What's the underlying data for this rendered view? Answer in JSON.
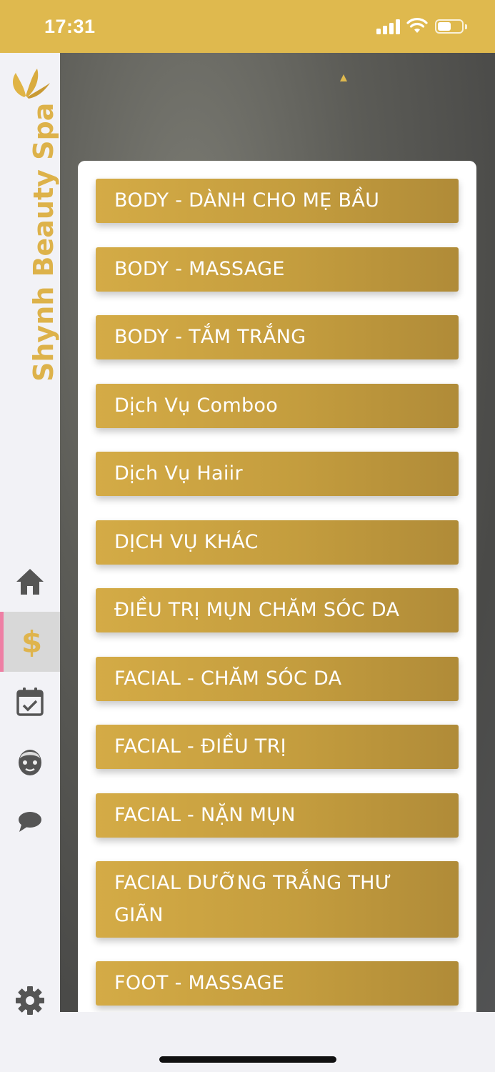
{
  "status": {
    "time": "17:31",
    "battery_level": 0.55
  },
  "sidebar": {
    "brand": "Shynh Beauty Spa",
    "nav": [
      {
        "icon": "home-icon",
        "active": false
      },
      {
        "icon": "dollar-icon",
        "label": "$",
        "active": true
      },
      {
        "icon": "calendar-check-icon",
        "active": false
      },
      {
        "icon": "face-mask-icon",
        "active": false
      },
      {
        "icon": "chat-bubble-icon",
        "active": false
      }
    ],
    "settings_icon": "gear-icon"
  },
  "services": [
    "BODY - DÀNH CHO MẸ BẦU",
    "BODY - MASSAGE",
    "BODY - TẮM TRẮNG",
    "Dịch Vụ Comboo",
    "Dịch Vụ Haiir",
    "DỊCH VỤ KHÁC",
    "ĐIỀU TRỊ MỤN CHĂM SÓC DA",
    "FACIAL - CHĂM SÓC DA",
    "FACIAL - ĐIỀU TRỊ",
    "FACIAL - NẶN MỤN",
    "FACIAL DƯỠNG TRẮNG THƯ GIÃN",
    "FOOT - MASSAGE",
    ""
  ],
  "colors": {
    "accent": "#dfb94e",
    "button": "#c49d3e",
    "active_marker": "#ee7fa4"
  }
}
